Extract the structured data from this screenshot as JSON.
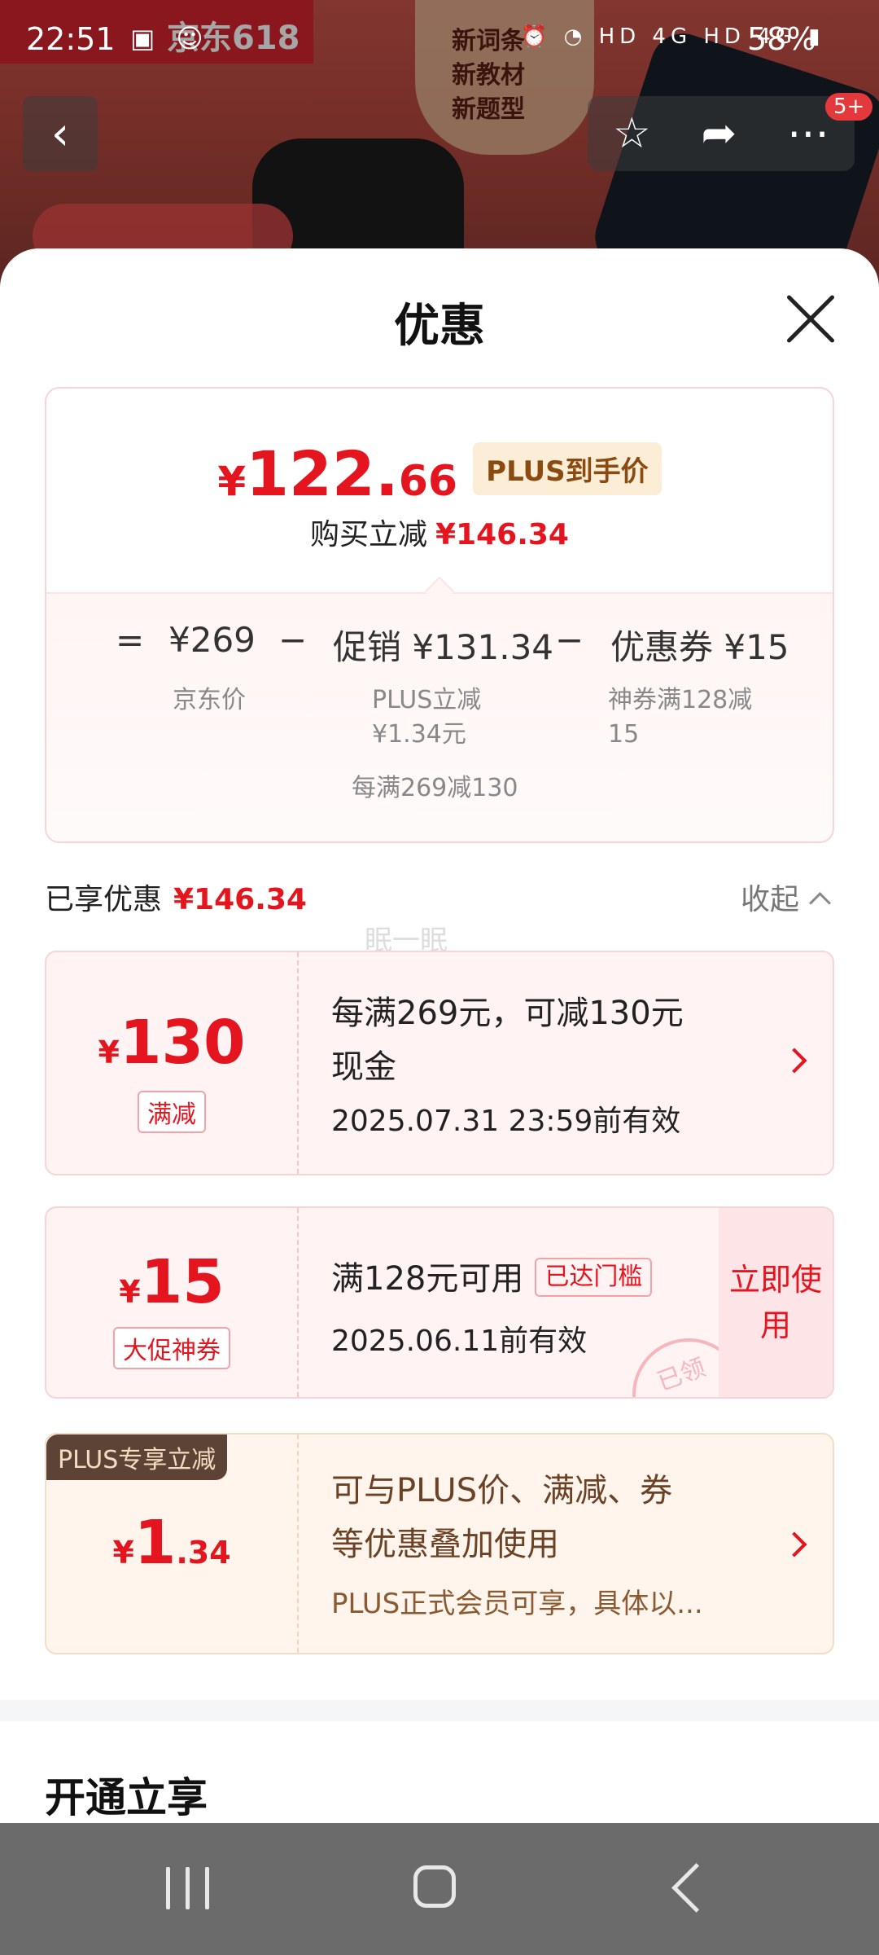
{
  "status_bar": {
    "time": "22:51",
    "battery": "58%",
    "network_labels": "HD 4G HD 4G"
  },
  "background_page": {
    "brand_text": "京东618",
    "badge_lines": [
      "新词条",
      "新教材",
      "新题型"
    ],
    "notification_count": "5+"
  },
  "sheet": {
    "title": "优惠",
    "summary": {
      "currency": "¥",
      "price_int": "122.",
      "price_dec": "66",
      "plus_tag": "PLUS到手价",
      "reduce_label": "购买立减",
      "reduce_value": "¥146.34",
      "calc": {
        "eq": "=",
        "jd_price": "¥269",
        "minus1": "−",
        "promo": "促销 ¥131.34",
        "minus2": "−",
        "coupon": "优惠券 ¥15",
        "jd_price_label": "京东价",
        "promo_detail_1": "PLUS立减",
        "promo_detail_2": "¥1.34元",
        "promo_detail_3": "每满269减130",
        "coupon_detail_1": "神券满128减",
        "coupon_detail_2": "15"
      }
    },
    "enjoyed_label": "已享优惠",
    "enjoyed_value": "¥146.34",
    "collapse_label": "收起",
    "watermark": "眠一眠",
    "coupons": [
      {
        "yen": "¥",
        "amount": "130",
        "tag": "满减",
        "line1": "每满269元，可减130元",
        "line1b": "现金",
        "line2": "2025.07.31 23:59前有效"
      },
      {
        "yen": "¥",
        "amount": "15",
        "tag": "大促神券",
        "line1": "满128元可用",
        "reached": "已达门槛",
        "line2": "2025.06.11前有效",
        "use_button": "立即使用",
        "stamp": "已领"
      },
      {
        "plus_label": "PLUS专享立减",
        "yen": "¥",
        "amount_int": "1",
        "amount_dec": ".34",
        "line1": "可与PLUS价、满减、券",
        "line1b": "等优惠叠加使用",
        "line2": "PLUS正式会员可享，具体以..."
      }
    ],
    "open_section_title": "开通立享"
  },
  "colors": {
    "accent_red": "#e4151f",
    "plus_brown": "#5c4335"
  }
}
